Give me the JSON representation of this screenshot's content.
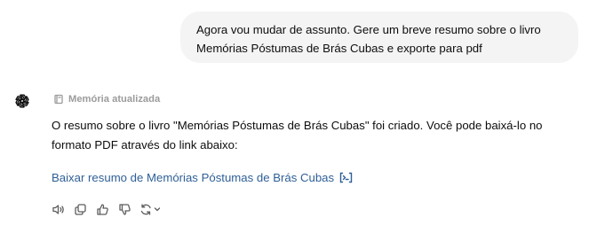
{
  "user_message": {
    "lines": [
      "Agora vou mudar de assunto. Gere um breve resumo sobre o livro",
      "Memórias Póstumas de Brás Cubas e exporte para pdf"
    ]
  },
  "assistant": {
    "avatar_icon": "openai-logo-icon",
    "memory_label": "Memória atualizada",
    "response_lines": [
      "O resumo sobre o livro \"Memórias Póstumas de Brás Cubas\" foi criado. Você pode baixá-lo no",
      "formato PDF através do link abaixo:"
    ],
    "download_link_text": "Baixar resumo de Memórias Póstumas de Brás Cubas",
    "download_link_icon": "code-interpreter-icon"
  },
  "actions": [
    {
      "name": "read-aloud",
      "icon": "speaker-icon"
    },
    {
      "name": "copy",
      "icon": "copy-icon"
    },
    {
      "name": "good-response",
      "icon": "thumbs-up-icon"
    },
    {
      "name": "bad-response",
      "icon": "thumbs-down-icon"
    },
    {
      "name": "regenerate",
      "icon": "regenerate-icon"
    }
  ],
  "colors": {
    "user_bubble": "#f4f4f4",
    "link": "#2e5f97",
    "memory_text": "#9b9b9b",
    "icon": "#5d5d5d"
  }
}
